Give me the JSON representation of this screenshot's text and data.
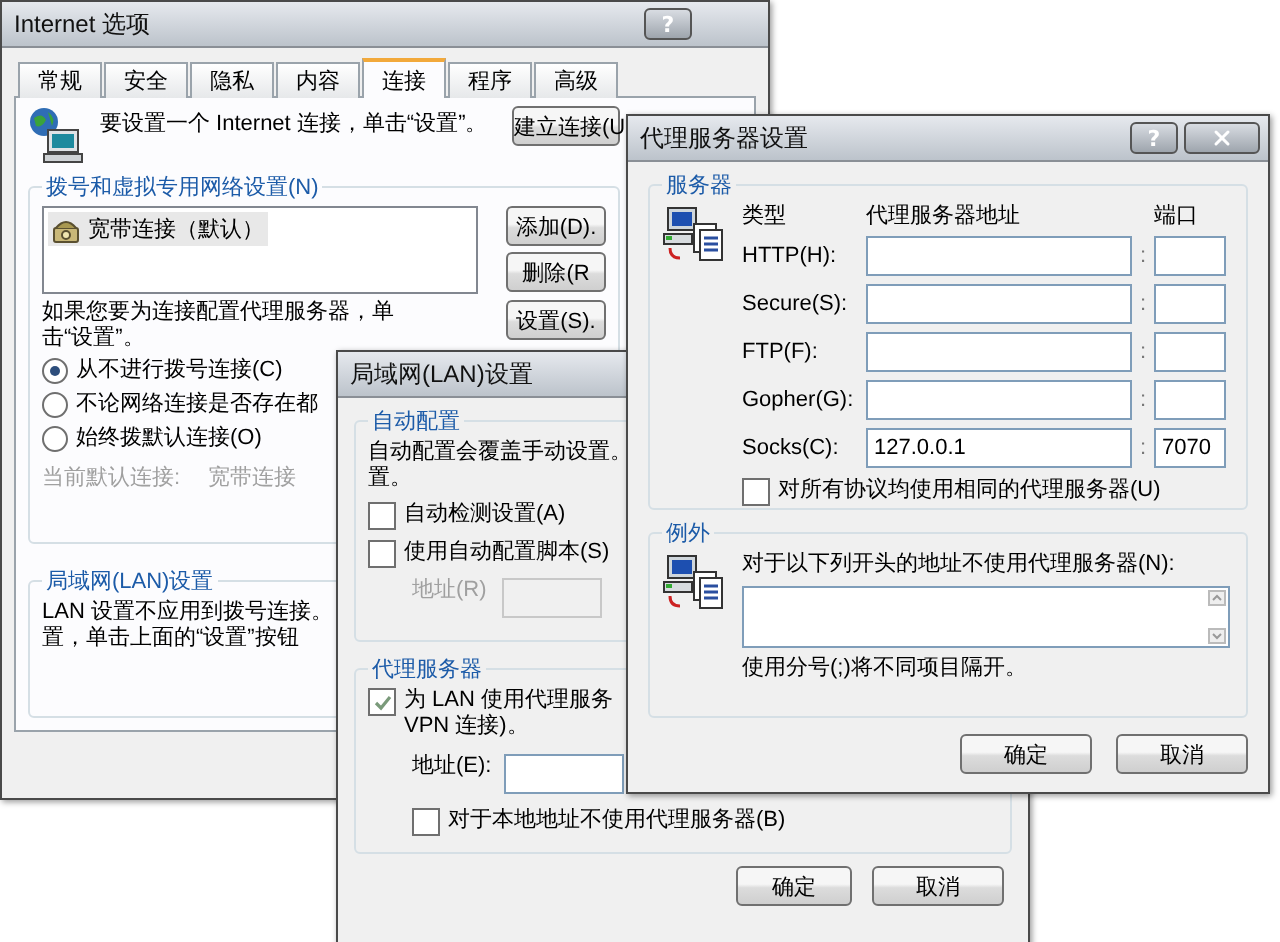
{
  "internet_options": {
    "title": "Internet 选项",
    "help_button": "?",
    "tabs": [
      {
        "label": "常规",
        "selected": false
      },
      {
        "label": "安全",
        "selected": false
      },
      {
        "label": "隐私",
        "selected": false
      },
      {
        "label": "内容",
        "selected": false
      },
      {
        "label": "连接",
        "selected": true
      },
      {
        "label": "程序",
        "selected": false
      },
      {
        "label": "高级",
        "selected": false
      }
    ],
    "setup_text": "要设置一个 Internet 连接，单击“设置”。",
    "setup_button": "建立连接(U",
    "dialup_group": {
      "title": "拨号和虚拟专用网络设置(N)",
      "connections": [
        {
          "label": "宽带连接（默认）",
          "selected": true
        }
      ],
      "buttons": [
        "添加(D).",
        "删除(R"
      ],
      "settings_button": "设置(S).",
      "proxy_hint": "如果您要为连接配置代理服务器，单击“设置”。",
      "dial_options": [
        {
          "label": "从不进行拨号连接(C)",
          "selected": true
        },
        {
          "label": "不论网络连接是否存在都",
          "selected": false
        },
        {
          "label": "始终拨默认连接(O)",
          "selected": false
        }
      ],
      "current_default": {
        "label": "当前默认连接:",
        "value": "宽带连接"
      }
    },
    "lan_group": {
      "title": "局域网(LAN)设置",
      "lines": [
        "LAN 设置不应用到拨号连接。",
        "置，单击上面的“设置”按钮"
      ]
    }
  },
  "lan_settings": {
    "title": "局域网(LAN)设置",
    "auto_group": {
      "title": "自动配置",
      "lines": [
        "自动配置会覆盖手动设置。",
        "置。"
      ],
      "options": [
        {
          "label": "自动检测设置(A)",
          "checked": false
        },
        {
          "label": "使用自动配置脚本(S)",
          "checked": false
        }
      ],
      "address": {
        "label": "地址(R)",
        "disabled": true
      }
    },
    "proxy_group": {
      "title": "代理服务器",
      "use_proxy": {
        "lines": [
          "为 LAN 使用代理服务",
          "VPN 连接)。"
        ],
        "checked": true
      },
      "address": {
        "label": "地址(E):"
      },
      "bypass_local": {
        "label": "对于本地地址不使用代理服务器(B)",
        "checked": false
      }
    },
    "buttons": [
      "确定",
      "取消"
    ]
  },
  "proxy_settings": {
    "title": "代理服务器设置",
    "help_button": "?",
    "servers_group": {
      "title": "服务器",
      "headers": [
        "类型",
        "代理服务器地址",
        "端口"
      ],
      "rows": [
        {
          "label": "HTTP(H):",
          "sep": ":"
        },
        {
          "label": "Secure(S):",
          "sep": ":"
        },
        {
          "label": "FTP(F):",
          "sep": ":"
        },
        {
          "label": "Gopher(G):",
          "sep": ":"
        },
        {
          "label": "Socks(C):",
          "sep": ":",
          "address": "127.0.0.1",
          "port": "7070"
        }
      ],
      "same_proxy": {
        "label": "对所有协议均使用相同的代理服务器(U)",
        "checked": false
      }
    },
    "exceptions_group": {
      "title": "例外",
      "label": "对于以下列开头的地址不使用代理服务器(N):",
      "note": "使用分号(;)将不同项目隔开。"
    },
    "buttons": [
      "确定",
      "取消"
    ]
  }
}
